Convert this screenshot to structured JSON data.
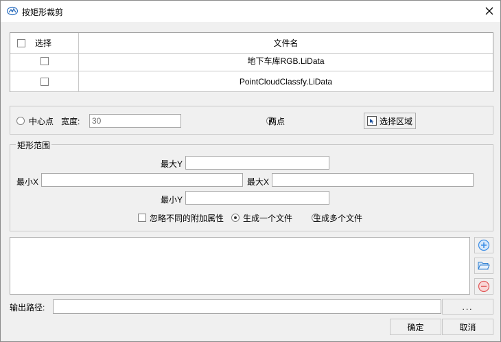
{
  "window": {
    "title": "按矩形裁剪",
    "close_symbol": "✕"
  },
  "grid": {
    "columns": {
      "select": "选择",
      "filename": "文件名"
    },
    "rows": [
      {
        "filename": "地下车库RGB.LiData"
      },
      {
        "filename": "PointCloudClassfy.LiData"
      }
    ]
  },
  "mode": {
    "center_point_label": "中心点",
    "width_label": "宽度:",
    "width_value": "30",
    "two_points_label": "两点",
    "select_area_button": "选择区域"
  },
  "rect_range": {
    "legend": "矩形范围",
    "max_y_label": "最大Y",
    "min_x_label": "最小X",
    "max_x_label": "最大X",
    "min_y_label": "最小Y",
    "max_y_value": "",
    "min_x_value": "",
    "max_x_value": "",
    "min_y_value": ""
  },
  "options": {
    "ignore_attrs_label": "忽略不同的附加属性",
    "one_file_label": "生成一个文件",
    "multi_files_label": "生成多个文件"
  },
  "output": {
    "label": "输出路径:",
    "value": "",
    "browse_label": "..."
  },
  "footer": {
    "ok_label": "确定",
    "cancel_label": "取消"
  },
  "icons": {
    "app": "app-logo-icon",
    "add": "add-circle-icon",
    "folder": "folder-open-icon",
    "remove": "remove-circle-icon"
  },
  "colors": {
    "add_blue": "#3c8ee6",
    "remove_red": "#e05a5a",
    "folder_blue": "#2f7fd1"
  }
}
